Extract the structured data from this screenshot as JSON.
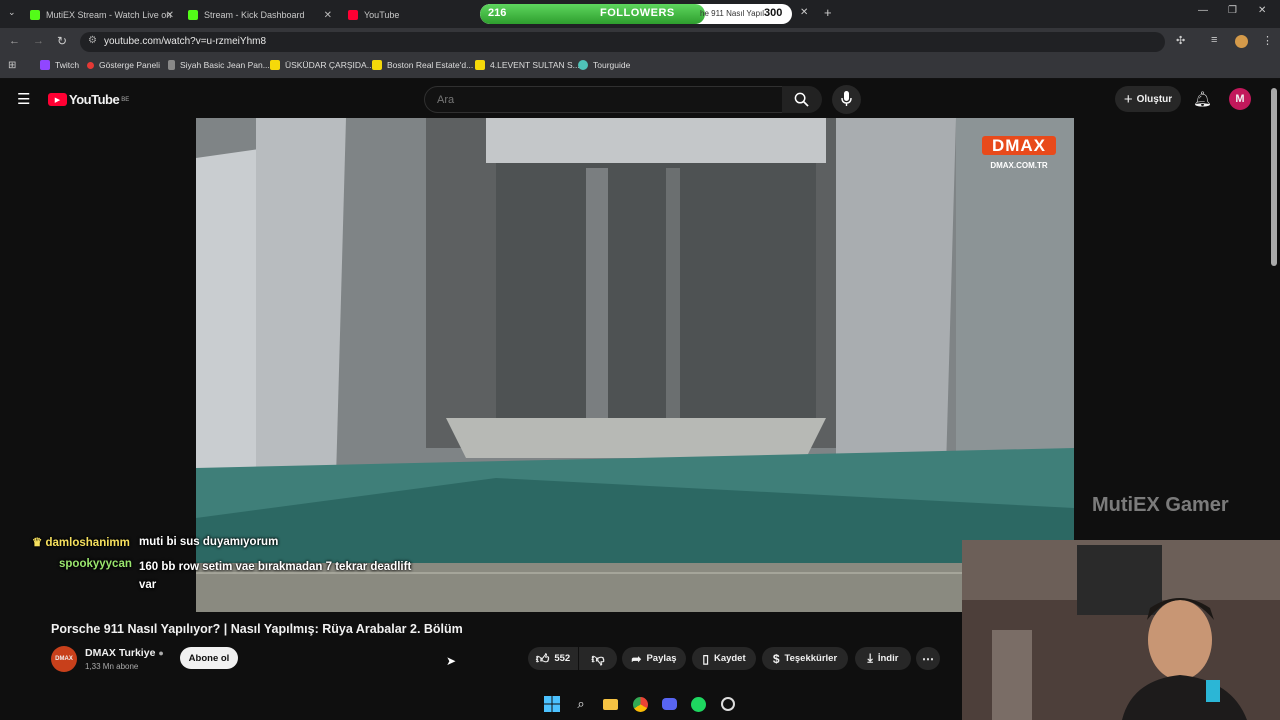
{
  "browser": {
    "tabs": [
      {
        "title": "MutiEX Stream - Watch Live on",
        "color": "#53fc18"
      },
      {
        "title": "Stream - Kick Dashboard",
        "color": "#53fc18"
      },
      {
        "title": "YouTube",
        "color": "#ff0033"
      },
      {
        "title": "he 911 Nasıl Yapıl",
        "color": "#ff0033"
      }
    ],
    "url": "youtube.com/watch?v=u-rzmeiYhm8",
    "bookmarks": [
      {
        "label": "Twitch",
        "color": "#9146ff"
      },
      {
        "label": "Gösterge Paneli",
        "color": "#e53935"
      },
      {
        "label": "Siyah Basic Jean Pan...",
        "color": "#888888"
      },
      {
        "label": "ÜSKÜDAR ÇARŞIDA...",
        "color": "#f5d90a"
      },
      {
        "label": "Boston Real Estate'd...",
        "color": "#f5d90a"
      },
      {
        "label": "4.LEVENT SULTAN S...",
        "color": "#f5d90a"
      },
      {
        "label": "Tourguide",
        "color": "#4fc3b8"
      }
    ]
  },
  "followers_goal": {
    "current": "216",
    "label": "FOLLOWERS",
    "goal": "300",
    "progress": 0.72
  },
  "youtube": {
    "logo": "YouTube",
    "region": "BE",
    "search_placeholder": "Ara",
    "create_label": "Oluştur",
    "avatar_letter": "M"
  },
  "video": {
    "channel_logo": "DMAX",
    "channel_site": "DMAX.COM.TR",
    "watermark": "MutiEX Gamer",
    "title": "Porsche 911 Nasıl Yapılıyor? | Nasıl Yapılmış: Rüya Arabalar 2. Bölüm",
    "channel_name": "DMAX Turkiye",
    "subscribers": "1,33 Mn abone",
    "subscribe_label": "Abone ol",
    "likes": "552",
    "share_label": "Paylaş",
    "save_label": "Kaydet",
    "thanks_label": "Teşekkürler",
    "download_label": "İndir"
  },
  "chat": [
    {
      "user": "damloshanimm",
      "message": "muti bi sus duyamıyorum",
      "user_color": "#f6e05e"
    },
    {
      "user": "spookyyycan",
      "message": "160 bb row setim vae bırakmadan 7 tekrar deadlift var",
      "user_color": "#9ae66e"
    }
  ],
  "taskbar": [
    "windows-icon",
    "search-icon",
    "file-explorer-icon",
    "chrome-icon",
    "discord-icon",
    "spotify-icon",
    "obs-icon"
  ]
}
